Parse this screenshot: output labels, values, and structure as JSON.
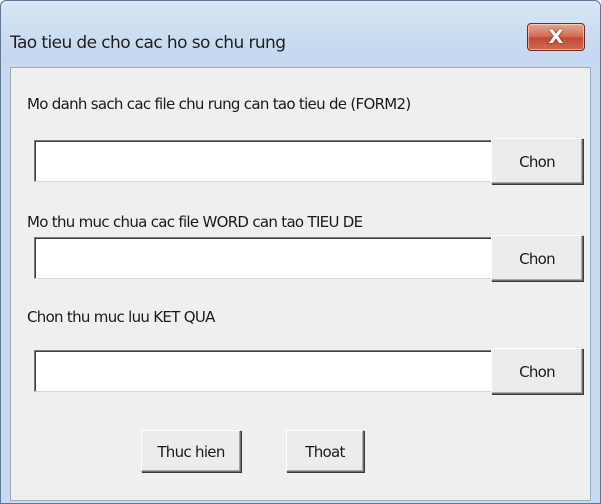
{
  "window": {
    "title": "Tao tieu de cho cac ho so chu rung",
    "close_glyph": "X"
  },
  "form": {
    "label1": "Mo danh sach cac file chu rung can tao tieu de (FORM2)",
    "input1_value": "",
    "chon1": "Chon",
    "label2": "Mo thu muc chua cac file WORD can tao TIEU DE",
    "input2_value": "",
    "chon2": "Chon",
    "label3": "Chon thu muc luu KET QUA",
    "input3_value": "",
    "chon3": "Chon",
    "run_button": "Thuc hien",
    "exit_button": "Thoat"
  },
  "colors": {
    "frame": "#c9daf0",
    "client": "#efefef",
    "close_button": "#c34b35"
  }
}
